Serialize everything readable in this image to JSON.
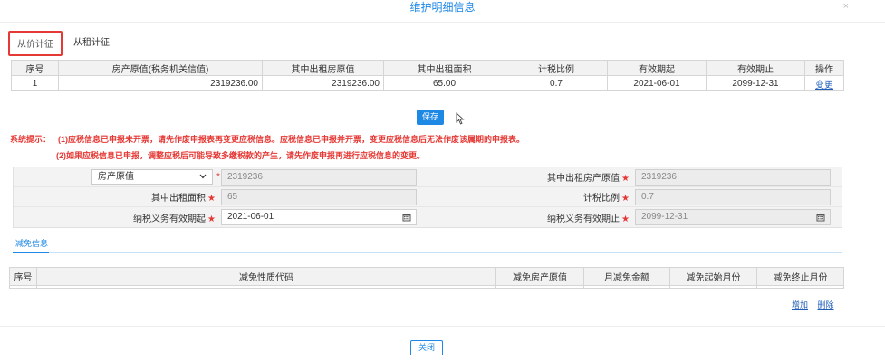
{
  "dialog": {
    "title": "维护明细信息",
    "close_glyph": "×",
    "close_label": "关闭"
  },
  "tabs": [
    {
      "label": "从价计征",
      "active": true
    },
    {
      "label": "从租计征",
      "active": false
    }
  ],
  "main_table": {
    "headers": [
      "序号",
      "房产原值(税务机关信值)",
      "其中出租房原值",
      "其中出租面积",
      "计税比例",
      "有效期起",
      "有效期止",
      "操作"
    ],
    "rows": [
      {
        "seq": "1",
        "original_value": "2319236.00",
        "rented_value": "2319236.00",
        "rented_area": "65.00",
        "tax_ratio": "0.7",
        "valid_from": "2021-06-01",
        "valid_to": "2099-12-31",
        "action": "变更"
      }
    ]
  },
  "save_label": "保存",
  "notice": {
    "prefix": "系统提示：",
    "line1": "(1)应税信息已申报未开票，请先作废申报表再变更应税信息。应税信息已申报并开票，变更应税信息后无法作废该属期的申报表。",
    "line2": "(2)如果应税信息已申报，调整应税后可能导致多缴税款的产生，请先作废申报再进行应税信息的变更。"
  },
  "form": {
    "select_value": "房产原值",
    "select_star": "*",
    "row1": {
      "value_left": "2319236",
      "label_right": "其中出租房产原值",
      "value_right": "2319236"
    },
    "row2": {
      "label_left": "其中出租面积",
      "value_left": "65",
      "label_right": "计税比例",
      "value_right": "0.7"
    },
    "row3": {
      "label_left": "纳税义务有效期起",
      "value_left": "2021-06-01",
      "label_right": "纳税义务有效期止",
      "value_right": "2099-12-31"
    },
    "required_mark": "★"
  },
  "relief": {
    "tab_label": "减免信息",
    "headers": [
      "序号",
      "减免性质代码",
      "减免房产原值",
      "月减免金额",
      "减免起始月份",
      "减免终止月份"
    ],
    "add_label": "增加",
    "delete_label": "删除"
  },
  "colors": {
    "accent": "#1e88e5",
    "warning": "#e53935"
  }
}
